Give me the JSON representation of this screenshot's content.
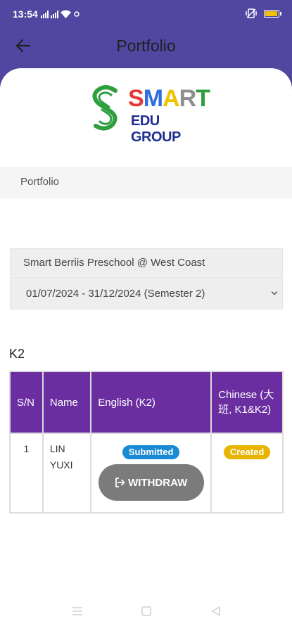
{
  "status_bar": {
    "time": "13:54"
  },
  "header": {
    "title": "Portfolio"
  },
  "logo": {
    "brand_letters": [
      "S",
      "M",
      "A",
      "R",
      "T"
    ],
    "brand_colors": [
      "#e53935",
      "#2f6ee0",
      "#f2c200",
      "#8e8e8e",
      "#2e9e3e"
    ],
    "tagline": "EDU GROUP"
  },
  "breadcrumb": {
    "label": "Portfolio"
  },
  "filters": {
    "school": "Smart Berriis Preschool @ West Coast",
    "period": "01/07/2024 - 31/12/2024 (Semester 2)"
  },
  "class_name": "K2",
  "table": {
    "headers": [
      "S/N",
      "Name",
      "English (K2)",
      "Chinese (大班, K1&K2)"
    ],
    "rows": [
      {
        "sn": "1",
        "name": "LIN YUXI",
        "english_status": "Submitted",
        "english_action": "WITHDRAW",
        "chinese_status": "Created"
      }
    ]
  },
  "colors": {
    "app_bar": "#5247a0",
    "table_header": "#6a2ea0",
    "badge_submitted": "#1a8ad4",
    "badge_created": "#e8b400",
    "withdraw_button": "#7b7b7b"
  },
  "icons": {
    "back": "arrow-left-icon",
    "select": "chevron-down-icon",
    "withdraw": "logout-icon",
    "nav_recents": "menu-icon",
    "nav_home": "square-icon",
    "nav_back": "triangle-back-icon"
  }
}
